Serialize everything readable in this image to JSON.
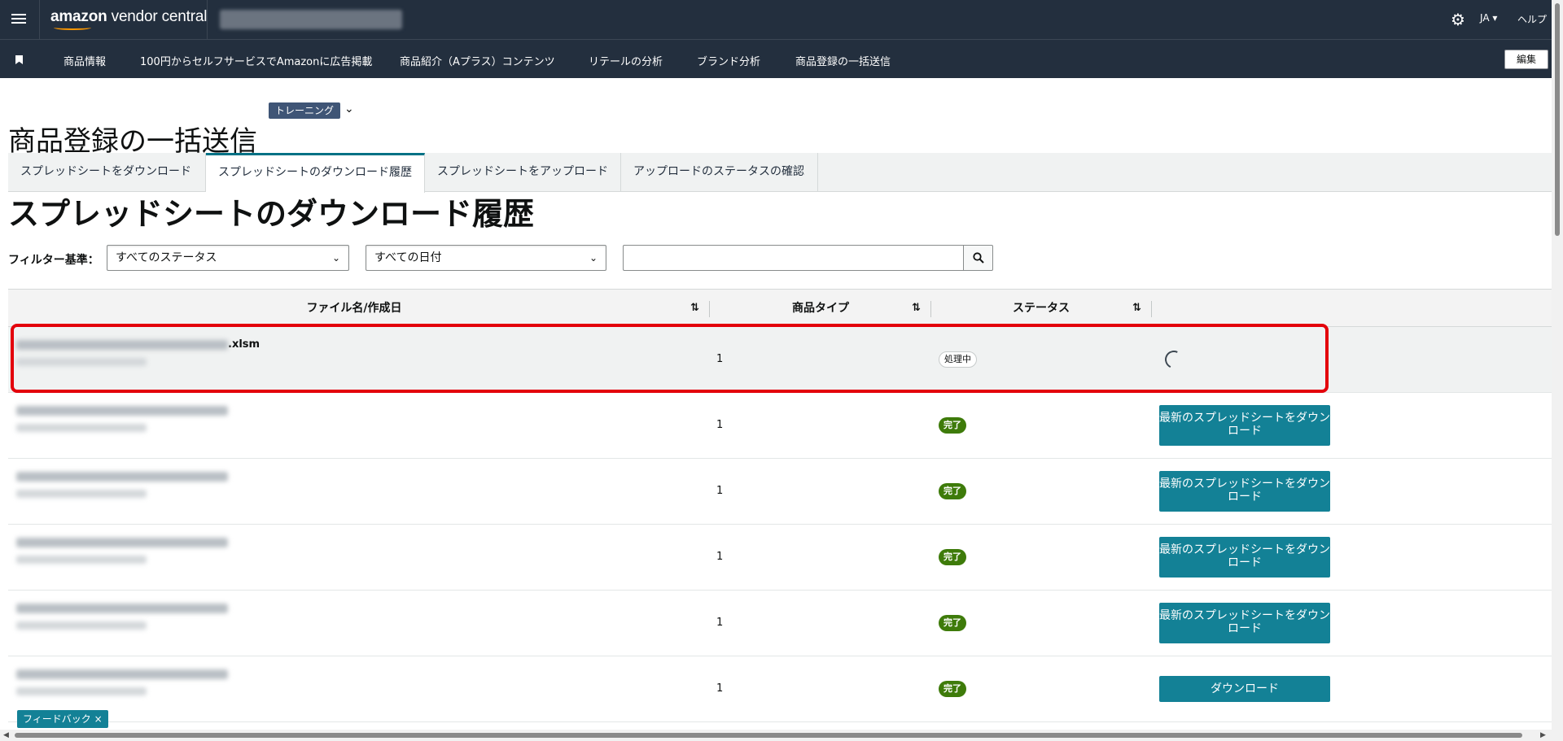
{
  "header": {
    "logo_text": "amazon",
    "logo_suffix": "vendor central",
    "account_name": "",
    "settings_icon": "gear-icon",
    "language": "JA ▾",
    "help": "ヘルプ"
  },
  "nav": {
    "items": [
      "商品情報",
      "100円からセルフサービスでAmazonに広告掲載",
      "商品紹介（Aプラス）コンテンツ",
      "リテールの分析",
      "ブランド分析",
      "商品登録の一括送信"
    ],
    "edit_label": "編集"
  },
  "page": {
    "training_label": "トレーニング",
    "title": "商品登録の一括送信",
    "section_title": "スプレッドシートのダウンロード履歴"
  },
  "tabs": [
    "スプレッドシートをダウンロード",
    "スプレッドシートのダウンロード履歴",
    "スプレッドシートをアップロード",
    "アップロードのステータスの確認"
  ],
  "active_tab": 1,
  "filters": {
    "label": "フィルター基準：",
    "status_value": "すべてのステータス",
    "date_value": "すべての日付",
    "search_value": ""
  },
  "table": {
    "headers": [
      "ファイル名/作成日",
      "商品タイプ",
      "ステータス"
    ],
    "rows": [
      {
        "file_suffix": ".xlsm",
        "qty": "1",
        "status": "処理中",
        "action": ""
      },
      {
        "file_suffix": "",
        "qty": "1",
        "status": "完了",
        "action": "最新のスプレッドシートをダウンロード"
      },
      {
        "file_suffix": "",
        "qty": "1",
        "status": "完了",
        "action": "最新のスプレッドシートをダウンロード"
      },
      {
        "file_suffix": "",
        "qty": "1",
        "status": "完了",
        "action": "最新のスプレッドシートをダウンロード"
      },
      {
        "file_suffix": "",
        "qty": "1",
        "status": "完了",
        "action": "最新のスプレッドシートをダウンロード"
      },
      {
        "file_suffix": "",
        "qty": "1",
        "status": "完了",
        "action": "ダウンロード"
      }
    ]
  },
  "feedback_label": "フィードバック ×",
  "colors": {
    "header_bg": "#232f3e",
    "accent": "#138196",
    "done_badge": "#3e7b0a",
    "highlight": "#e3000b"
  }
}
